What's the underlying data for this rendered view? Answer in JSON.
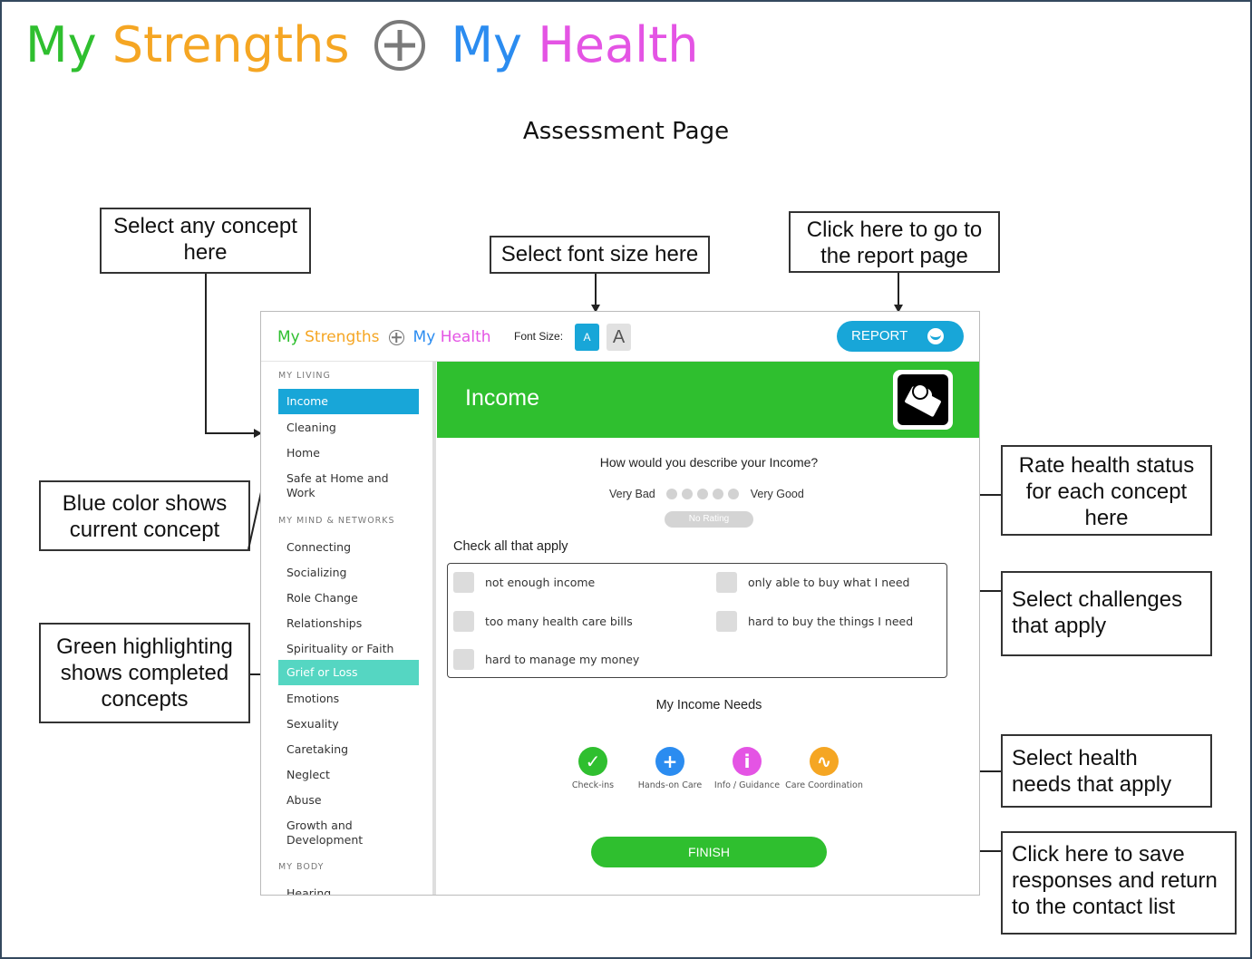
{
  "header": {
    "logo": {
      "part1": "My",
      "part2": "Strengths",
      "part3": "My",
      "part4": "Health"
    },
    "page_heading": "Assessment Page"
  },
  "callouts": {
    "select_concept": "Select any concept here",
    "font_size": "Select font size here",
    "report": "Click here to go to the report page",
    "blue_color": "Blue color shows current concept",
    "green_highlight": "Green highlighting shows completed concepts",
    "rate_health": "Rate health status for each concept here",
    "select_challenges": "Select challenges that apply",
    "select_needs": "Select health needs that apply",
    "finish": "Click here to save responses and return to the contact list"
  },
  "app": {
    "font_size_label": "Font Size:",
    "font_small": "A",
    "font_large": "A",
    "report_label": "REPORT",
    "sidebar": {
      "sections": [
        "MY LIVING",
        "MY MIND & NETWORKS",
        "MY BODY"
      ],
      "living": [
        "Income",
        "Cleaning",
        "Home",
        "Safe at Home and Work"
      ],
      "mind": [
        "Connecting",
        "Socializing",
        "Role Change",
        "Relationships",
        "Spirituality or Faith",
        "Grief or Loss",
        "Emotions",
        "Sexuality",
        "Caretaking",
        "Neglect",
        "Abuse",
        "Growth and Development"
      ],
      "body": [
        "Hearing"
      ],
      "current": "Income",
      "completed": "Grief or Loss"
    },
    "concept_title": "Income",
    "question": "How would you describe your Income?",
    "rating": {
      "low": "Very Bad",
      "high": "Very Good",
      "none": "No Rating",
      "scale": 5,
      "selected": null
    },
    "check_title": "Check all that apply",
    "challenges": [
      "not enough income",
      "only able to buy what I need",
      "too many health care bills",
      "hard to buy the things I need",
      "hard to manage my money"
    ],
    "needs_title": "My Income Needs",
    "needs": [
      {
        "label": "Check-ins",
        "icon": "checkmark-icon",
        "color": "#2fbf2f",
        "glyph": "✓"
      },
      {
        "label": "Hands-on Care",
        "icon": "plus-icon",
        "color": "#2b8cf0",
        "glyph": "+"
      },
      {
        "label": "Info / Guidance",
        "icon": "info-icon",
        "color": "#e454e4",
        "glyph": "i"
      },
      {
        "label": "Care Coordination",
        "icon": "coordination-icon",
        "color": "#f5a623",
        "glyph": "∿"
      }
    ],
    "finish_label": "FINISH"
  },
  "colors": {
    "green": "#2fbf2f",
    "orange": "#f5a623",
    "blue": "#2b8cf0",
    "pink": "#e454e4",
    "accent": "#18a6d8",
    "completed": "#55d6c2"
  }
}
